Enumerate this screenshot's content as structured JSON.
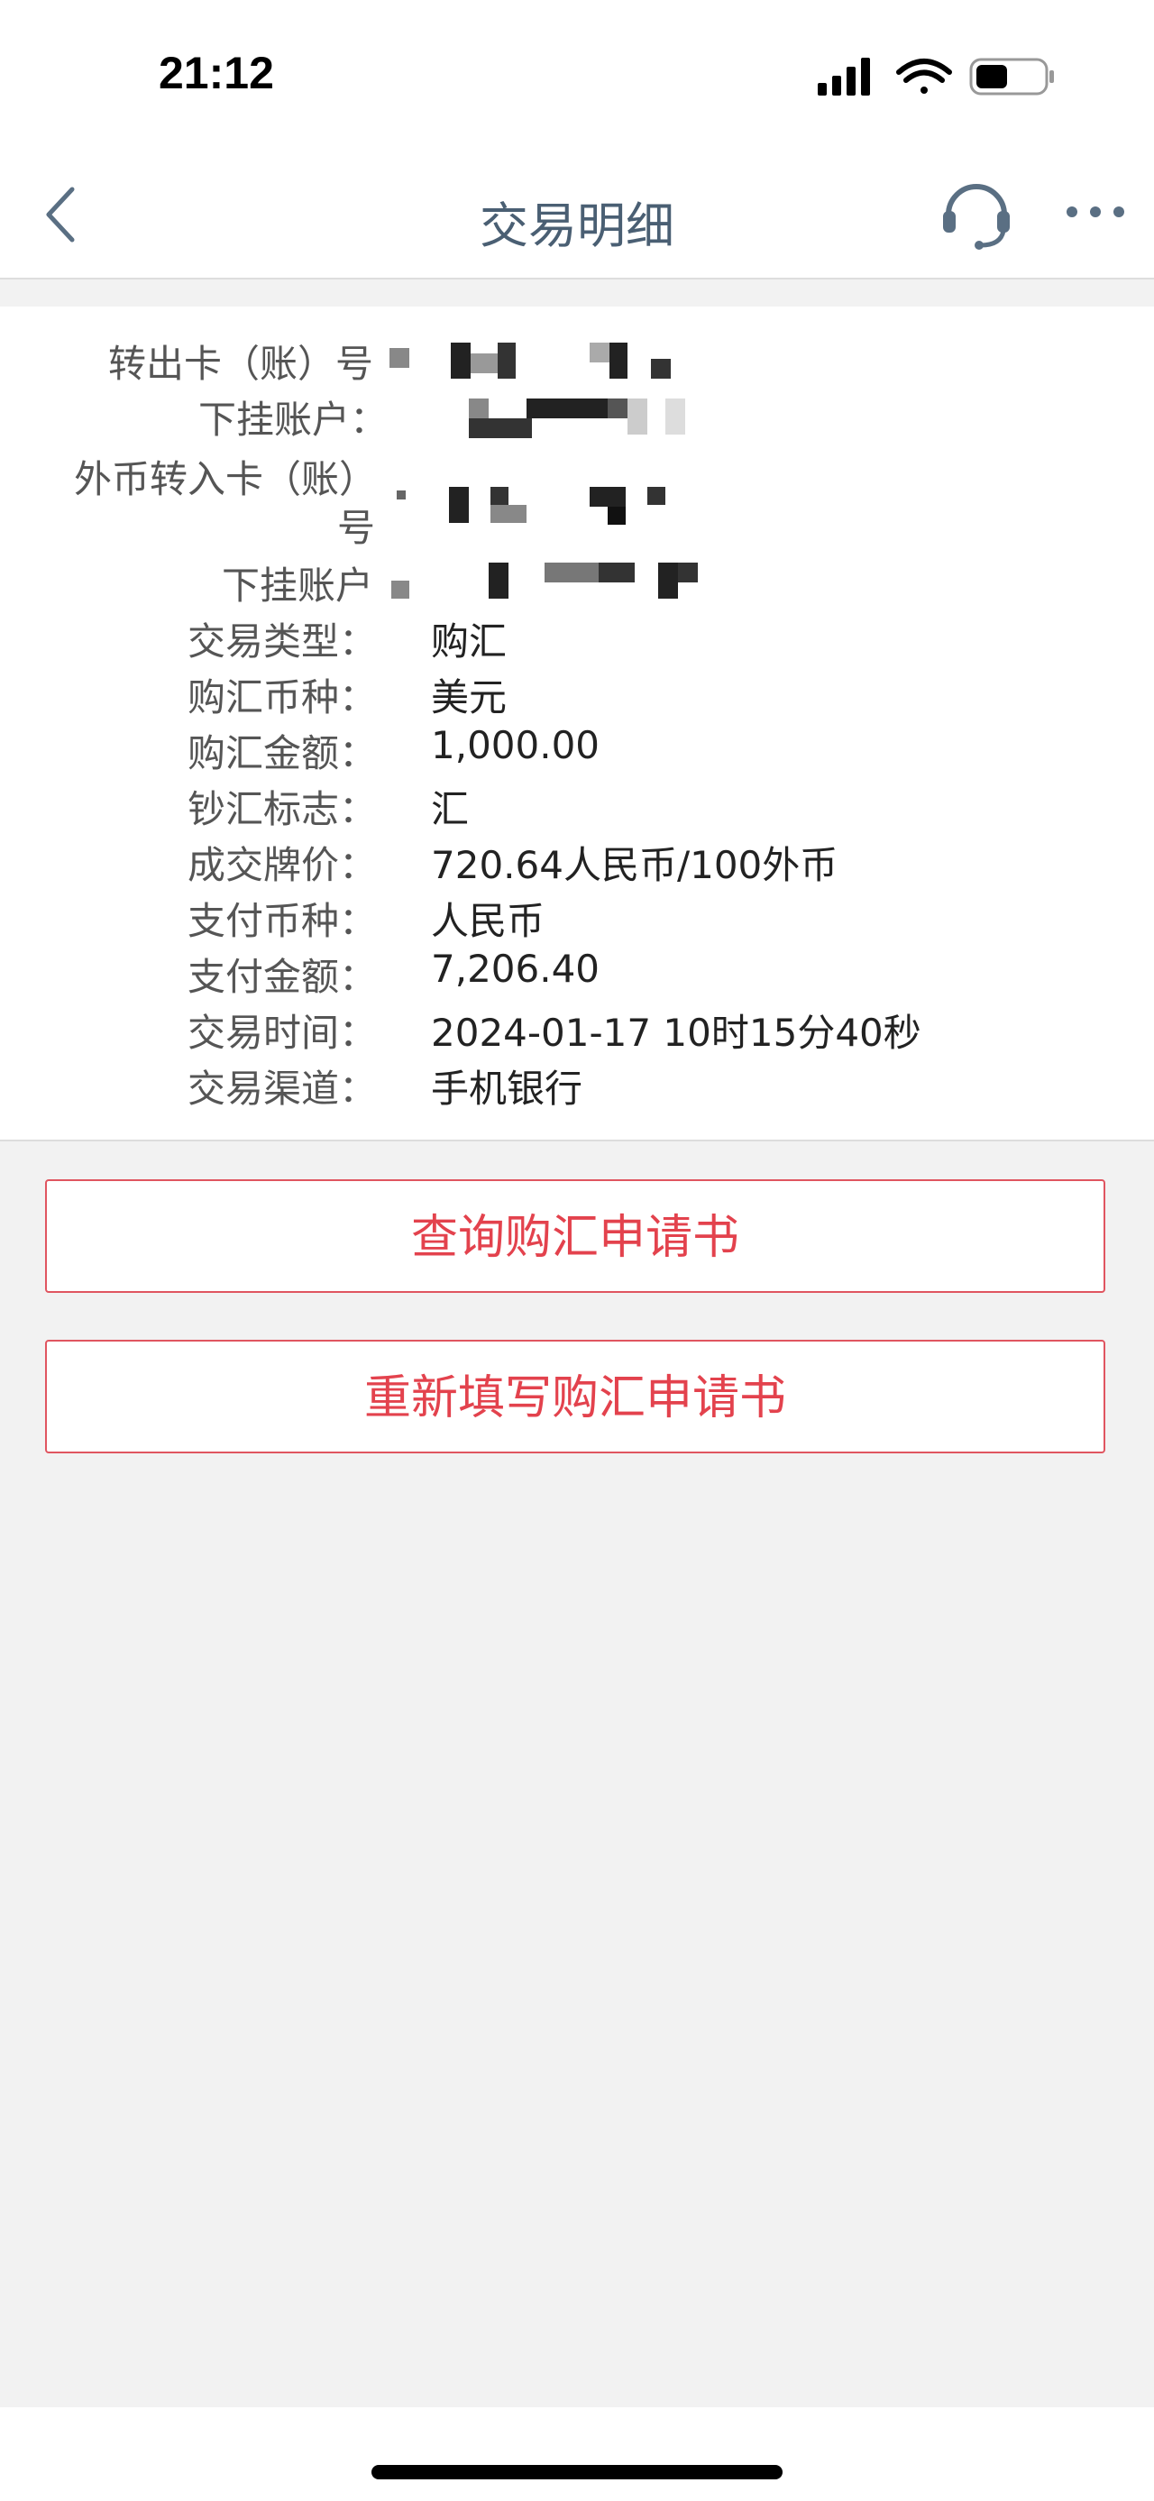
{
  "status_bar": {
    "time": "21:12",
    "icons": [
      "signal-icon",
      "wifi-icon",
      "battery-icon"
    ]
  },
  "nav": {
    "title": "交易明细",
    "back_icon": "chevron-left-icon",
    "service_icon": "headset-icon",
    "more_icon": "more-dots-icon"
  },
  "details": {
    "from_card_label": "转出卡（账）号",
    "from_sub_account_label": "下挂账户：",
    "to_card_label_line1": "外币转入卡（账）",
    "to_card_label_line2": "号",
    "to_sub_account_label": "下挂账户",
    "rows": [
      {
        "label": "交易类型：",
        "value": "购汇"
      },
      {
        "label": "购汇币种：",
        "value": "美元"
      },
      {
        "label": "购汇金额：",
        "value": "1,000.00"
      },
      {
        "label": "钞汇标志：",
        "value": "汇"
      },
      {
        "label": "成交牌价：",
        "value": "720.64人民币/100外币"
      },
      {
        "label": "支付币种：",
        "value": "人民币"
      },
      {
        "label": "支付金额：",
        "value": "7,206.40"
      },
      {
        "label": "交易时间：",
        "value": "2024-01-17 10时15分40秒"
      },
      {
        "label": "交易渠道：",
        "value": "手机银行"
      }
    ]
  },
  "actions": {
    "query_label": "查询购汇申请书",
    "refill_label": "重新填写购汇申请书"
  },
  "colors": {
    "accent": "#e3424d",
    "title": "#4a5f73",
    "background": "#f2f2f2"
  }
}
